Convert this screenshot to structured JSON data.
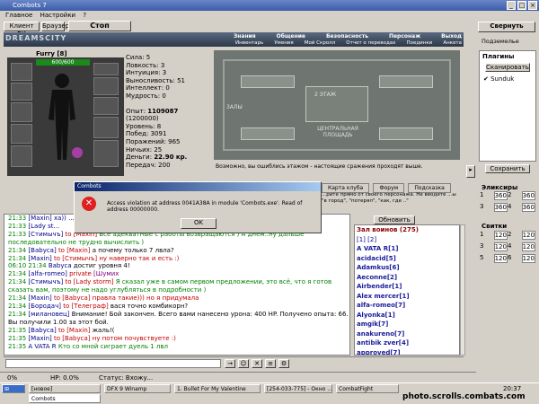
{
  "window": {
    "title": "Combots 7"
  },
  "menu": [
    "Главное",
    "Настройки",
    "?"
  ],
  "toolbar": {
    "client_bk": "Клиент БК",
    "browser": "Браузер",
    "stop": "Стоп"
  },
  "right": {
    "collapse": "Свернуть",
    "subtitle": "Подземелье",
    "plugins_title": "Плагины",
    "scan": "Сканировать",
    "plugin_item": "Sunduk",
    "save": "Сохранить",
    "elixirs_title": "Эликсиры",
    "elixirs": [
      "1",
      "360",
      "2",
      "360",
      "3",
      "360",
      "4",
      "360"
    ],
    "scrolls_title": "Свитки",
    "scrolls": [
      "1",
      "120",
      "2",
      "120",
      "3",
      "120",
      "4",
      "120",
      "5",
      "120",
      "6",
      "120"
    ]
  },
  "header": {
    "logo": "DREAMSCITY",
    "nav_top": [
      "Знания",
      "Общение",
      "Безопасность",
      "Персонаж",
      "Выход"
    ],
    "nav_bottom": [
      "Инвентарь",
      "Умения",
      "Мой Скролл",
      "Отчет о переводах",
      "Поединки",
      "Анкета"
    ]
  },
  "character": {
    "name": "Furry",
    "level": "[8]",
    "hp": "600/600",
    "stats": [
      "Сила: 5",
      "Ловкость: 3",
      "Интуиция: 3",
      "Выносливость: 51",
      "Интеллект: 0",
      "Мудрость: 0"
    ],
    "info": [
      "Опыт:",
      "Уровень: 8",
      "Побед: 3091",
      "Поражений: 965",
      "Ничьих: 25",
      "Деньги:",
      "Передач: 200"
    ],
    "exp": "1109087",
    "exp_next": "(1200000)",
    "money": "22.90 кр."
  },
  "map": {
    "labels": [
      "2 ЭТАЖ",
      "ЗАЛЫ",
      "ЦЕНТРАЛЬНАЯ ПЛОЩАДЬ"
    ],
    "caption": "Возможно, вы ошиблись этажом - настоящие сражения проходят выше."
  },
  "tabs": [
    "Карта клуба",
    "Форум",
    "Подсказка"
  ],
  "desc": "...рите прямо от своего персонажа. Не вводите ...ы \"в город\", \"потерял\", \"как, где ..\"",
  "dialog": {
    "title": "Combots",
    "message": "Access violation at address 0041A38A in module 'Combots.exe'. Read of address 00000000.",
    "ok": "OK"
  },
  "chat": [
    {
      "t": "21:33",
      "n": "[Maxin]",
      "r": "",
      "msg": "ха)) ...",
      "c": "n"
    },
    {
      "t": "21:33",
      "n": "[Lady st...",
      "r": "",
      "msg": "",
      "c": "n"
    },
    {
      "t": "21:33",
      "n": "[Стимычъ]",
      "r": "to [Maxin]",
      "msg": "Все адекватные с работы возвращаются ) А днём..ну дальше последовательно не трудно вычислить )",
      "c": "m"
    },
    {
      "t": "21:34",
      "n": "[Babyca]",
      "r": "to [Maxin]",
      "msg": "а почему только 7 лвла?",
      "c": ""
    },
    {
      "t": "21:34",
      "n": "[Maxin]",
      "r": "to [Стимычъ]",
      "msg": "ну наверно так и есть :)",
      "c": "r"
    },
    {
      "t": "06:10 21:34",
      "n": "Babyca",
      "r": "",
      "msg": "достиг уровня 4!",
      "c": ""
    },
    {
      "t": "21:34",
      "n": "[alfa-romeo]",
      "r": "private",
      "msg": "[Шумих",
      "c": "p"
    },
    {
      "t": "21:34",
      "n": "[Стимычъ]",
      "r": "to [Lady storm]",
      "msg": "Я сказал уже в самом первом предложении, это всё, что я готов сказать вам, поэтому не надо углубляться в подробности )",
      "c": "m"
    },
    {
      "t": "21:34",
      "n": "[Maxin]",
      "r": "to [Babyca]",
      "msg": "правла такие))) но я придумала",
      "c": "r"
    },
    {
      "t": "21:34",
      "n": "[Бородач]",
      "r": "to [Телеграф]",
      "msg": "вася точно комбикорн?",
      "c": ""
    },
    {
      "t": "21:34",
      "n": "[милановец]",
      "r": "",
      "msg": "Внимание! Бой закончен. Всего вами нанесено урона: 400 HP. Получено опыта: 66. Вы получили 1.00 за этот бой.",
      "c": ""
    },
    {
      "t": "21:35",
      "n": "[Babyca]",
      "r": "to [Maxin]",
      "msg": "жаль!(",
      "c": ""
    },
    {
      "t": "21:35",
      "n": "[Maxin]",
      "r": "to [Babyca]",
      "msg": "ну потом почувствуете :)",
      "c": "r"
    },
    {
      "t": "21:35",
      "n": "A VATA R",
      "r": "",
      "msg": "Кто со мной сиграет дуель 1 лвл",
      "c": "m"
    }
  ],
  "players": {
    "refresh": "Обновить",
    "hall": "Зал воинов (275)",
    "pages": [
      "[1]",
      "[2]"
    ],
    "list": [
      "A VATA R[1]",
      "acidacid[5]",
      "Adamkus[6]",
      "Aeconne[2]",
      "Airbender[1]",
      "Alex mercer[1]",
      "alfa-romeo[7]",
      "Alyonka[1]",
      "amgik[7]",
      "anakureno[7]",
      "antibik zver[4]",
      "approved[7]"
    ]
  },
  "status": {
    "zoom": "0%",
    "hp": "HP: 0.0%",
    "state": "Статус: Вхожу..."
  },
  "taskbar": {
    "tray": [
      "[новое]",
      "Combots"
    ],
    "tasks": [
      "DFX 9 Winamp",
      "1. Bullet For My Valentine",
      "[254-033-775] - Окно ...",
      "CombatFight"
    ],
    "clock": "20:37",
    "watermark": "photo.scrolls.combats.com"
  }
}
